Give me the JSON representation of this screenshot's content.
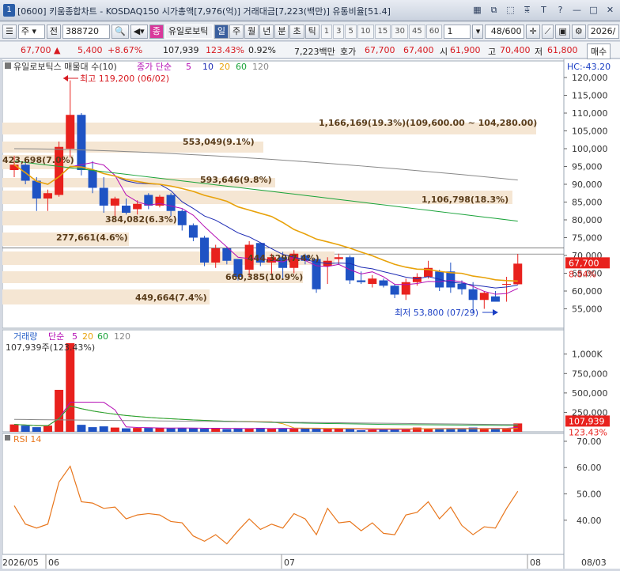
{
  "titlebar": {
    "window_no": "1",
    "title": "[0600] 키움종합차트 - KOSDAQ150 시가총액[7,976(억)] 거래대금[7,223(백만)] 유통비율[51.4]",
    "icons": [
      "grid-icon",
      "copy-icon",
      "link-icon",
      "pin-icon",
      "text-icon",
      "help-icon",
      "minimize-icon",
      "maximize-icon",
      "close-icon"
    ],
    "icon_glyphs": [
      "▦",
      "⧉",
      "⬚",
      "ꔯ",
      "T",
      "?",
      "—",
      "□",
      "✕"
    ]
  },
  "toolbar": {
    "cycle_a": "주",
    "prev": "전",
    "code": "388720",
    "badge": "종",
    "stock_name": "유일로보틱",
    "periods": [
      "일",
      "주",
      "월",
      "년",
      "분",
      "초",
      "틱"
    ],
    "active_period": "일",
    "numbers": [
      "1",
      "3",
      "5",
      "10",
      "15",
      "30",
      "45",
      "60"
    ],
    "unit_value": "1",
    "count": "48/600",
    "date": "2026/"
  },
  "pricebar": {
    "price": "67,700",
    "change": "5,400",
    "change_pct": "+8.67%",
    "volume": "107,939",
    "vol_ratio": "123.43%",
    "turnover": "0.92%",
    "amount": "7,223백만",
    "quote_label": "호가",
    "ask": "67,700",
    "bid": "67,400",
    "open_label": "시",
    "open": "61,900",
    "high_label": "고",
    "high": "70,400",
    "low_label": "저",
    "low": "61,800",
    "buy_label": "매수"
  },
  "legend": {
    "price_name": "유일로보틱스 매물대 수(10)",
    "ma_prefix": "종가 단순",
    "ma_periods": [
      "5",
      "10",
      "20",
      "60",
      "120"
    ],
    "hc": "HC:-43.20",
    "vol_name": "거래량",
    "vol_ma_prefix": "단순",
    "vol_current": "107,939주(123.43%)",
    "rsi_name": "RSI 14"
  },
  "colors": {
    "up": "#e8211d",
    "down": "#1f53c4",
    "ma5": "#b510b5",
    "ma10": "#1d2bb4",
    "ma20": "#e8a20a",
    "ma60": "#1aa33a",
    "ma120": "#888888",
    "rsi": "#e8761c",
    "profile": "#f5e6d3"
  },
  "annotations": {
    "high_mark": "최고 119,200 (06/02)",
    "low_mark": "최저 53,800 (07/29)",
    "price_tag": "67,700",
    "pct_tag": "8.84%",
    "vol_tag": "107,939",
    "vol_pct_tag": "123.43%"
  },
  "price_profile": [
    {
      "label": "1,166,169(19.3%)(109,600.00 ~ 104,280.00)"
    },
    {
      "label": "553,049(9.1%)"
    },
    {
      "label": "593,646(9.8%)"
    },
    {
      "label": "1,106,798(18.3%)"
    },
    {
      "label": "384,082(6.3%)"
    },
    {
      "label": "277,661(4.6%)"
    },
    {
      "label": "444,329(7.4%)"
    },
    {
      "label": "660,385(10.9%)"
    },
    {
      "label": "449,664(7.4%)"
    },
    {
      "label": "423,698(7.0%)"
    }
  ],
  "chart_data": {
    "type": "candlestick",
    "price_axis": {
      "ticks": [
        "120,000",
        "115,000",
        "110,000",
        "105,000",
        "100,000",
        "95,000",
        "90,000",
        "85,000",
        "80,000",
        "75,000",
        "70,000",
        "65,000",
        "60,000",
        "55,000"
      ],
      "ylim": [
        50000,
        122000
      ]
    },
    "volume_axis": {
      "ticks": [
        "1,000K",
        "750,000",
        "500,000",
        "250,000"
      ],
      "ylim": [
        0,
        1150000
      ]
    },
    "rsi_axis": {
      "ticks": [
        "70.00",
        "60.00",
        "50.00",
        "40.00"
      ],
      "ylim": [
        27,
        73
      ]
    },
    "x_labels": [
      "2026/05",
      "06",
      "07",
      "08",
      "08/03"
    ],
    "candles": [
      {
        "o": 94000,
        "h": 98000,
        "l": 92000,
        "c": 95500
      },
      {
        "o": 95500,
        "h": 96500,
        "l": 90000,
        "c": 91000
      },
      {
        "o": 91000,
        "h": 92000,
        "l": 82500,
        "c": 86000
      },
      {
        "o": 86000,
        "h": 88500,
        "l": 82500,
        "c": 87500
      },
      {
        "o": 87000,
        "h": 102000,
        "l": 86500,
        "c": 100500
      },
      {
        "o": 100000,
        "h": 119200,
        "l": 97500,
        "c": 109500
      },
      {
        "o": 109500,
        "h": 110000,
        "l": 92500,
        "c": 94000
      },
      {
        "o": 94000,
        "h": 96500,
        "l": 87500,
        "c": 89000
      },
      {
        "o": 89000,
        "h": 92000,
        "l": 82000,
        "c": 84000
      },
      {
        "o": 84000,
        "h": 86500,
        "l": 81000,
        "c": 86000
      },
      {
        "o": 84000,
        "h": 86000,
        "l": 81500,
        "c": 82000
      },
      {
        "o": 83000,
        "h": 85500,
        "l": 81500,
        "c": 84500
      },
      {
        "o": 87000,
        "h": 87500,
        "l": 83000,
        "c": 84000
      },
      {
        "o": 84000,
        "h": 87000,
        "l": 83500,
        "c": 86500
      },
      {
        "o": 87000,
        "h": 87500,
        "l": 81000,
        "c": 82500
      },
      {
        "o": 82500,
        "h": 83000,
        "l": 77000,
        "c": 78500
      },
      {
        "o": 78500,
        "h": 79000,
        "l": 74000,
        "c": 75000
      },
      {
        "o": 75000,
        "h": 75500,
        "l": 67000,
        "c": 68000
      },
      {
        "o": 68000,
        "h": 73000,
        "l": 66500,
        "c": 72000
      },
      {
        "o": 72000,
        "h": 72500,
        "l": 67500,
        "c": 68500
      },
      {
        "o": 69000,
        "h": 69000,
        "l": 63000,
        "c": 64000
      },
      {
        "o": 66000,
        "h": 74000,
        "l": 64000,
        "c": 73000
      },
      {
        "o": 73500,
        "h": 73000,
        "l": 67000,
        "c": 68000
      },
      {
        "o": 68000,
        "h": 70500,
        "l": 64500,
        "c": 69500
      },
      {
        "o": 69500,
        "h": 71000,
        "l": 63500,
        "c": 66500
      },
      {
        "o": 66500,
        "h": 71500,
        "l": 65000,
        "c": 70500
      },
      {
        "o": 70000,
        "h": 70500,
        "l": 67500,
        "c": 68500
      },
      {
        "o": 69000,
        "h": 69000,
        "l": 59500,
        "c": 60500
      },
      {
        "o": 67000,
        "h": 69500,
        "l": 62000,
        "c": 68500
      },
      {
        "o": 69000,
        "h": 70500,
        "l": 67500,
        "c": 69500
      },
      {
        "o": 69500,
        "h": 70000,
        "l": 62000,
        "c": 63000
      },
      {
        "o": 63000,
        "h": 65500,
        "l": 62000,
        "c": 62500
      },
      {
        "o": 62000,
        "h": 64500,
        "l": 61000,
        "c": 63500
      },
      {
        "o": 63000,
        "h": 63500,
        "l": 61000,
        "c": 61500
      },
      {
        "o": 61500,
        "h": 62000,
        "l": 58000,
        "c": 59000
      },
      {
        "o": 59000,
        "h": 63500,
        "l": 57500,
        "c": 62500
      },
      {
        "o": 62500,
        "h": 65000,
        "l": 61500,
        "c": 64000
      },
      {
        "o": 64000,
        "h": 68500,
        "l": 63500,
        "c": 66500
      },
      {
        "o": 65500,
        "h": 66000,
        "l": 60000,
        "c": 61000
      },
      {
        "o": 65500,
        "h": 68000,
        "l": 59500,
        "c": 61000
      },
      {
        "o": 62000,
        "h": 63000,
        "l": 59000,
        "c": 60500
      },
      {
        "o": 60500,
        "h": 62500,
        "l": 53800,
        "c": 57500
      },
      {
        "o": 57500,
        "h": 60000,
        "l": 55000,
        "c": 59500
      },
      {
        "o": 58500,
        "h": 60000,
        "l": 57000,
        "c": 57000
      },
      {
        "o": 61900,
        "h": 64000,
        "l": 57000,
        "c": 62000
      },
      {
        "o": 61900,
        "h": 70400,
        "l": 61800,
        "c": 67700
      }
    ],
    "volumes": [
      95000,
      80000,
      60000,
      80000,
      540000,
      1140000,
      90000,
      60000,
      70000,
      55000,
      45000,
      50000,
      50000,
      50000,
      45000,
      50000,
      45000,
      40000,
      50000,
      35000,
      45000,
      40000,
      50000,
      40000,
      45000,
      40000,
      45000,
      40000,
      35000,
      40000,
      35000,
      20000,
      25000,
      30000,
      40000,
      40000,
      55000,
      40000,
      35000,
      45000,
      40000,
      55000,
      40000,
      45000,
      40000,
      107939
    ],
    "rsi": [
      45.5,
      38.5,
      37,
      38.5,
      54.5,
      60.5,
      47,
      46.5,
      44.5,
      45,
      40.5,
      42,
      42.5,
      42,
      39.5,
      39,
      34,
      32,
      34.5,
      31,
      36,
      40.5,
      36.5,
      38.5,
      37,
      42.5,
      40.5,
      34.5,
      44.5,
      39,
      39.5,
      36,
      39,
      35,
      34.5,
      42,
      43,
      47,
      40.5,
      45,
      38,
      34.5,
      37.5,
      37,
      44.5,
      51
    ]
  }
}
